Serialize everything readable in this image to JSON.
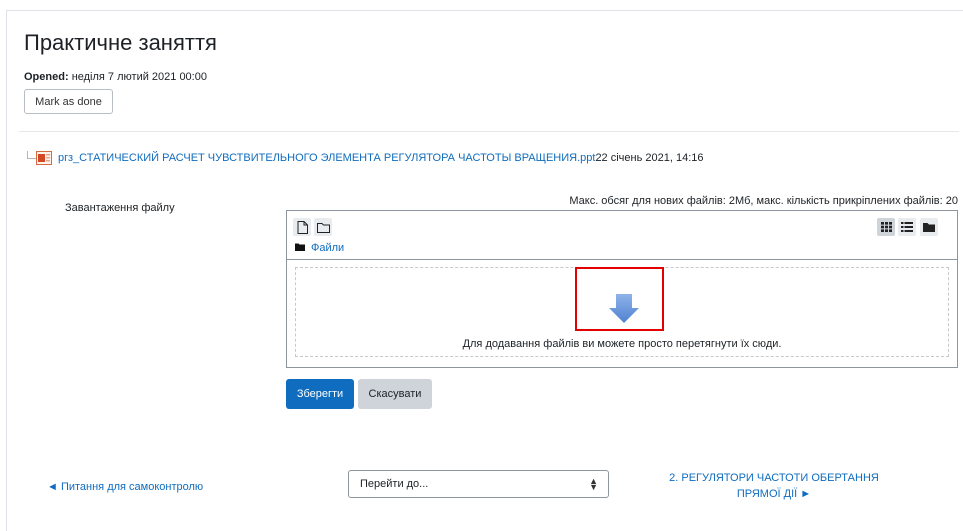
{
  "activity": {
    "title": "Практичне заняття",
    "opened_label": "Opened:",
    "opened_value": "неділя 7 лютий 2021 00:00",
    "mark_as_done": "Mark as done"
  },
  "submitted_file": {
    "icon": "powerpoint-file-icon",
    "name": "ргз_СТАТИЧЕСКИЙ РАСЧЕТ ЧУВСТВИТЕЛЬНОГО ЭЛЕМЕНТА РЕГУЛЯТОРА ЧАСТОТЫ ВРАЩЕНИЯ.ppt",
    "date": "22 січень 2021, 14:16"
  },
  "upload": {
    "label": "Завантаження файлу",
    "limits": "Макс. обсяг для нових файлів: 2Мб, макс. кількість прикріплених файлів: 20",
    "toolbar_left_icons": [
      "add-file-icon",
      "create-folder-icon"
    ],
    "toolbar_right_icons": [
      "grid-view-icon",
      "list-view-icon",
      "tree-view-icon"
    ],
    "breadcrumb": "Файли",
    "drop_hint": "Для додавання файлів ви можете просто перетягнути їх сюди."
  },
  "buttons": {
    "save": "Зберегти",
    "cancel": "Скасувати"
  },
  "navigation": {
    "prev": "◄ Питання для самоконтролю",
    "jump_placeholder": "Перейти до...",
    "next": "2. РЕГУЛЯТОРИ ЧАСТОТИ ОБЕРТАННЯ ПРЯМОЇ ДІЇ ►"
  },
  "colors": {
    "link": "#0f6cbf",
    "primary_button": "#0f6cbf",
    "highlight_box": "#e30000",
    "drop_arrow": "#5b8fd6"
  }
}
